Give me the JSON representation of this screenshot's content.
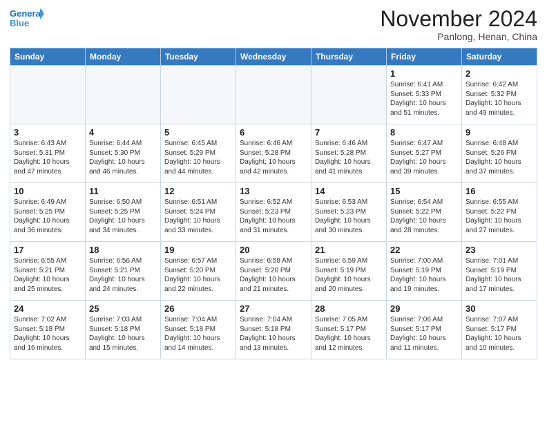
{
  "header": {
    "logo_line1": "General",
    "logo_line2": "Blue",
    "month": "November 2024",
    "location": "Panlong, Henan, China"
  },
  "days_of_week": [
    "Sunday",
    "Monday",
    "Tuesday",
    "Wednesday",
    "Thursday",
    "Friday",
    "Saturday"
  ],
  "weeks": [
    [
      {
        "day": "",
        "info": ""
      },
      {
        "day": "",
        "info": ""
      },
      {
        "day": "",
        "info": ""
      },
      {
        "day": "",
        "info": ""
      },
      {
        "day": "",
        "info": ""
      },
      {
        "day": "1",
        "info": "Sunrise: 6:41 AM\nSunset: 5:33 PM\nDaylight: 10 hours and 51 minutes."
      },
      {
        "day": "2",
        "info": "Sunrise: 6:42 AM\nSunset: 5:32 PM\nDaylight: 10 hours and 49 minutes."
      }
    ],
    [
      {
        "day": "3",
        "info": "Sunrise: 6:43 AM\nSunset: 5:31 PM\nDaylight: 10 hours and 47 minutes."
      },
      {
        "day": "4",
        "info": "Sunrise: 6:44 AM\nSunset: 5:30 PM\nDaylight: 10 hours and 46 minutes."
      },
      {
        "day": "5",
        "info": "Sunrise: 6:45 AM\nSunset: 5:29 PM\nDaylight: 10 hours and 44 minutes."
      },
      {
        "day": "6",
        "info": "Sunrise: 6:46 AM\nSunset: 5:28 PM\nDaylight: 10 hours and 42 minutes."
      },
      {
        "day": "7",
        "info": "Sunrise: 6:46 AM\nSunset: 5:28 PM\nDaylight: 10 hours and 41 minutes."
      },
      {
        "day": "8",
        "info": "Sunrise: 6:47 AM\nSunset: 5:27 PM\nDaylight: 10 hours and 39 minutes."
      },
      {
        "day": "9",
        "info": "Sunrise: 6:48 AM\nSunset: 5:26 PM\nDaylight: 10 hours and 37 minutes."
      }
    ],
    [
      {
        "day": "10",
        "info": "Sunrise: 6:49 AM\nSunset: 5:25 PM\nDaylight: 10 hours and 36 minutes."
      },
      {
        "day": "11",
        "info": "Sunrise: 6:50 AM\nSunset: 5:25 PM\nDaylight: 10 hours and 34 minutes."
      },
      {
        "day": "12",
        "info": "Sunrise: 6:51 AM\nSunset: 5:24 PM\nDaylight: 10 hours and 33 minutes."
      },
      {
        "day": "13",
        "info": "Sunrise: 6:52 AM\nSunset: 5:23 PM\nDaylight: 10 hours and 31 minutes."
      },
      {
        "day": "14",
        "info": "Sunrise: 6:53 AM\nSunset: 5:23 PM\nDaylight: 10 hours and 30 minutes."
      },
      {
        "day": "15",
        "info": "Sunrise: 6:54 AM\nSunset: 5:22 PM\nDaylight: 10 hours and 28 minutes."
      },
      {
        "day": "16",
        "info": "Sunrise: 6:55 AM\nSunset: 5:22 PM\nDaylight: 10 hours and 27 minutes."
      }
    ],
    [
      {
        "day": "17",
        "info": "Sunrise: 6:55 AM\nSunset: 5:21 PM\nDaylight: 10 hours and 25 minutes."
      },
      {
        "day": "18",
        "info": "Sunrise: 6:56 AM\nSunset: 5:21 PM\nDaylight: 10 hours and 24 minutes."
      },
      {
        "day": "19",
        "info": "Sunrise: 6:57 AM\nSunset: 5:20 PM\nDaylight: 10 hours and 22 minutes."
      },
      {
        "day": "20",
        "info": "Sunrise: 6:58 AM\nSunset: 5:20 PM\nDaylight: 10 hours and 21 minutes."
      },
      {
        "day": "21",
        "info": "Sunrise: 6:59 AM\nSunset: 5:19 PM\nDaylight: 10 hours and 20 minutes."
      },
      {
        "day": "22",
        "info": "Sunrise: 7:00 AM\nSunset: 5:19 PM\nDaylight: 10 hours and 19 minutes."
      },
      {
        "day": "23",
        "info": "Sunrise: 7:01 AM\nSunset: 5:19 PM\nDaylight: 10 hours and 17 minutes."
      }
    ],
    [
      {
        "day": "24",
        "info": "Sunrise: 7:02 AM\nSunset: 5:18 PM\nDaylight: 10 hours and 16 minutes."
      },
      {
        "day": "25",
        "info": "Sunrise: 7:03 AM\nSunset: 5:18 PM\nDaylight: 10 hours and 15 minutes."
      },
      {
        "day": "26",
        "info": "Sunrise: 7:04 AM\nSunset: 5:18 PM\nDaylight: 10 hours and 14 minutes."
      },
      {
        "day": "27",
        "info": "Sunrise: 7:04 AM\nSunset: 5:18 PM\nDaylight: 10 hours and 13 minutes."
      },
      {
        "day": "28",
        "info": "Sunrise: 7:05 AM\nSunset: 5:17 PM\nDaylight: 10 hours and 12 minutes."
      },
      {
        "day": "29",
        "info": "Sunrise: 7:06 AM\nSunset: 5:17 PM\nDaylight: 10 hours and 11 minutes."
      },
      {
        "day": "30",
        "info": "Sunrise: 7:07 AM\nSunset: 5:17 PM\nDaylight: 10 hours and 10 minutes."
      }
    ]
  ]
}
